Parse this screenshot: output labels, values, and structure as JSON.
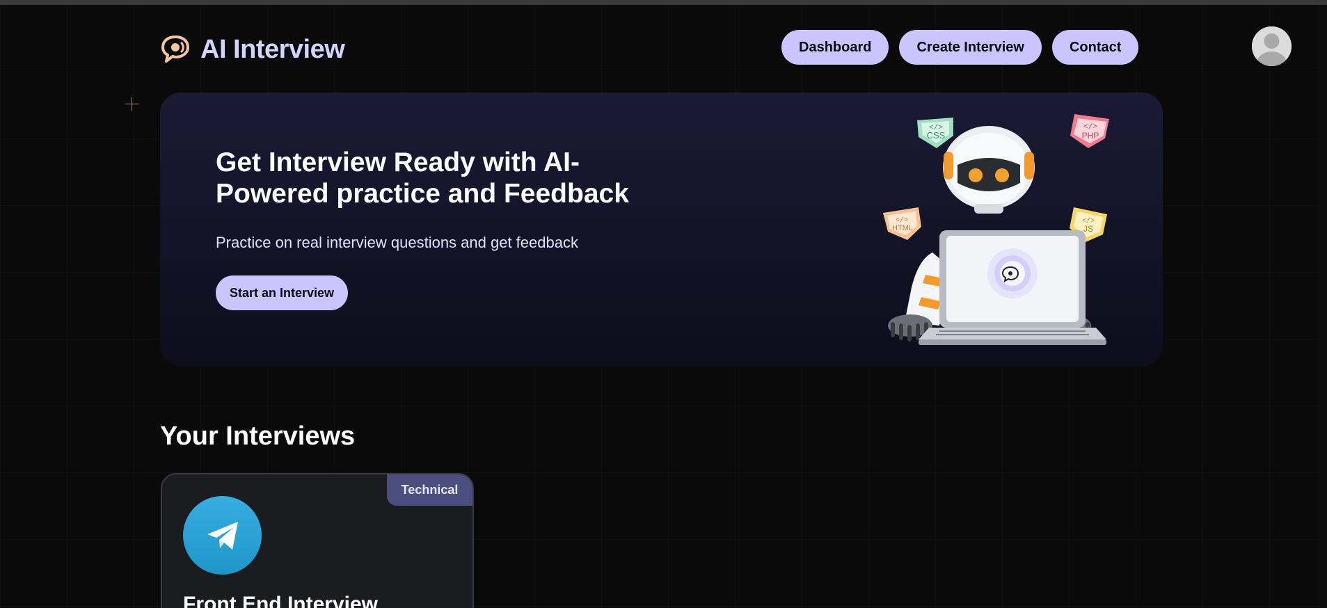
{
  "header": {
    "app_title": "AI Interview",
    "nav": [
      {
        "label": "Dashboard"
      },
      {
        "label": "Create Interview"
      },
      {
        "label": "Contact"
      }
    ]
  },
  "hero": {
    "title": "Get Interview Ready with AI-Powered practice and Feedback",
    "subtitle": "Practice on real interview questions and get feedback",
    "cta_label": "Start an Interview",
    "tech_badges": [
      "CSS",
      "PHP",
      "HTML",
      "JS"
    ]
  },
  "interviews_section": {
    "title": "Your Interviews",
    "cards": [
      {
        "badge": "Technical",
        "title": "Front End Interview"
      }
    ]
  },
  "colors": {
    "background": "#0a0a0b",
    "accent": "#cac4ff",
    "hero_bg": "#1a1a35",
    "card_bg": "#1b1c20",
    "badge_bg": "#4a4f7f",
    "telegram_blue": "#37aee2"
  },
  "icons": {
    "logo": "chat-bubble-icon",
    "avatar": "user-avatar-icon",
    "card_logo": "telegram-icon"
  }
}
